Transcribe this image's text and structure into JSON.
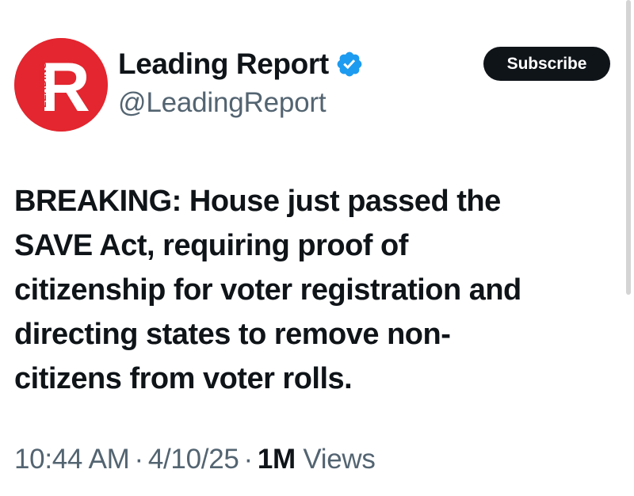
{
  "account": {
    "display_name": "Leading Report",
    "handle": "@LeadingReport",
    "avatar_letter": "R",
    "avatar_side_text": "LEADING",
    "verified_icon": "verified-badge-icon",
    "verified_color": "#1d9bf0",
    "brand_color": "#e3262f"
  },
  "actions": {
    "subscribe_label": "Subscribe"
  },
  "tweet": {
    "lines": [
      "BREAKING: House just passed the",
      "SAVE Act, requiring proof of",
      "citizenship for voter registration and",
      "directing states to remove non-",
      "citizens from voter rolls."
    ]
  },
  "meta": {
    "time": "10:44 AM",
    "date": "4/10/25",
    "separator": "·",
    "views_count": "1M",
    "views_label": "Views"
  }
}
